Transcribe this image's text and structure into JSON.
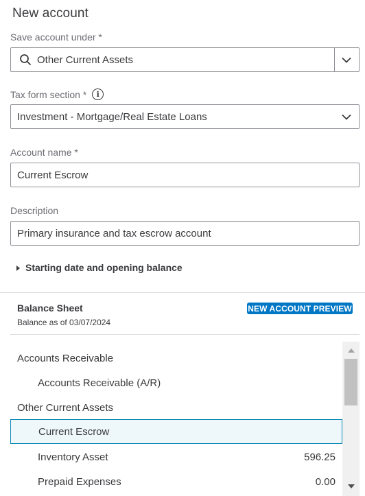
{
  "title": "New account",
  "save_under": {
    "label": "Save account under *",
    "value": "Other Current Assets"
  },
  "tax_form": {
    "label": "Tax form section *",
    "value": "Investment - Mortgage/Real Estate Loans"
  },
  "account_name": {
    "label": "Account name *",
    "value": "Current Escrow"
  },
  "description": {
    "label": "Description",
    "value": "Primary insurance and tax escrow account"
  },
  "opening_balance_toggle": "Starting date and opening balance",
  "balance_sheet": {
    "title": "Balance Sheet",
    "subtitle": "Balance as of 03/07/2024",
    "badge": "NEW ACCOUNT PREVIEW",
    "rows": [
      {
        "name": "Accounts Receivable",
        "amount": ""
      },
      {
        "name": "Accounts Receivable (A/R)",
        "amount": ""
      },
      {
        "name": "Other Current Assets",
        "amount": ""
      },
      {
        "name": "Current Escrow",
        "amount": ""
      },
      {
        "name": "Inventory Asset",
        "amount": "596.25"
      },
      {
        "name": "Prepaid Expenses",
        "amount": "0.00"
      }
    ]
  },
  "colors": {
    "accent": "#0077c5",
    "selected_border": "#0d89b8",
    "selected_bg": "#eef8fb",
    "text": "#393a3d"
  }
}
